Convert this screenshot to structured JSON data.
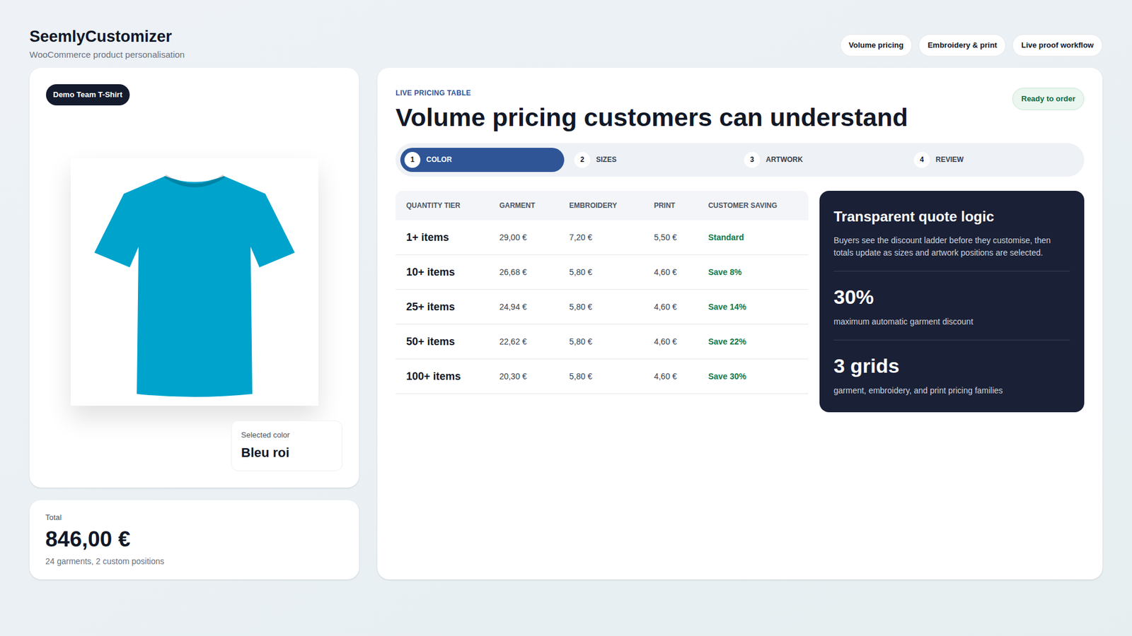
{
  "header": {
    "title": "SeemlyCustomizer",
    "subtitle": "WooCommerce product personalisation",
    "pills": [
      "Volume pricing",
      "Embroidery & print",
      "Live proof workflow"
    ]
  },
  "product": {
    "badge": "Demo Team T-Shirt",
    "color_label": "Selected color",
    "color_value": "Bleu roi",
    "color": "#00a3cc"
  },
  "total": {
    "label": "Total",
    "amount": "846,00 €",
    "detail": "24 garments, 2 custom positions"
  },
  "pricing": {
    "eyebrow": "LIVE PRICING TABLE",
    "heading": "Volume pricing customers can understand",
    "status": "Ready to order",
    "steps": [
      {
        "number": "1",
        "label": "COLOR",
        "selected": true
      },
      {
        "number": "2",
        "label": "SIZES",
        "selected": false
      },
      {
        "number": "3",
        "label": "ARTWORK",
        "selected": false
      },
      {
        "number": "4",
        "label": "REVIEW",
        "selected": false
      }
    ],
    "columns": [
      "QUANTITY TIER",
      "GARMENT",
      "EMBROIDERY",
      "PRINT",
      "CUSTOMER SAVING"
    ],
    "rows": [
      {
        "tier": "1+ items",
        "garment": "29,00 €",
        "embroidery": "7,20 €",
        "print": "5,50 €",
        "saving": "Standard"
      },
      {
        "tier": "10+ items",
        "garment": "26,68 €",
        "embroidery": "5,80 €",
        "print": "4,60 €",
        "saving": "Save 8%"
      },
      {
        "tier": "25+ items",
        "garment": "24,94 €",
        "embroidery": "5,80 €",
        "print": "4,60 €",
        "saving": "Save 14%"
      },
      {
        "tier": "50+ items",
        "garment": "22,62 €",
        "embroidery": "5,80 €",
        "print": "4,60 €",
        "saving": "Save 22%"
      },
      {
        "tier": "100+ items",
        "garment": "20,30 €",
        "embroidery": "5,80 €",
        "print": "4,60 €",
        "saving": "Save 30%"
      }
    ]
  },
  "panel": {
    "title": "Transparent quote logic",
    "text": "Buyers see the discount ladder before they customise, then totals update as sizes and artwork positions are selected.",
    "stats": [
      {
        "value": "30%",
        "label": "maximum automatic garment discount"
      },
      {
        "value": "3 grids",
        "label": "garment, embroidery, and print pricing families"
      }
    ]
  }
}
